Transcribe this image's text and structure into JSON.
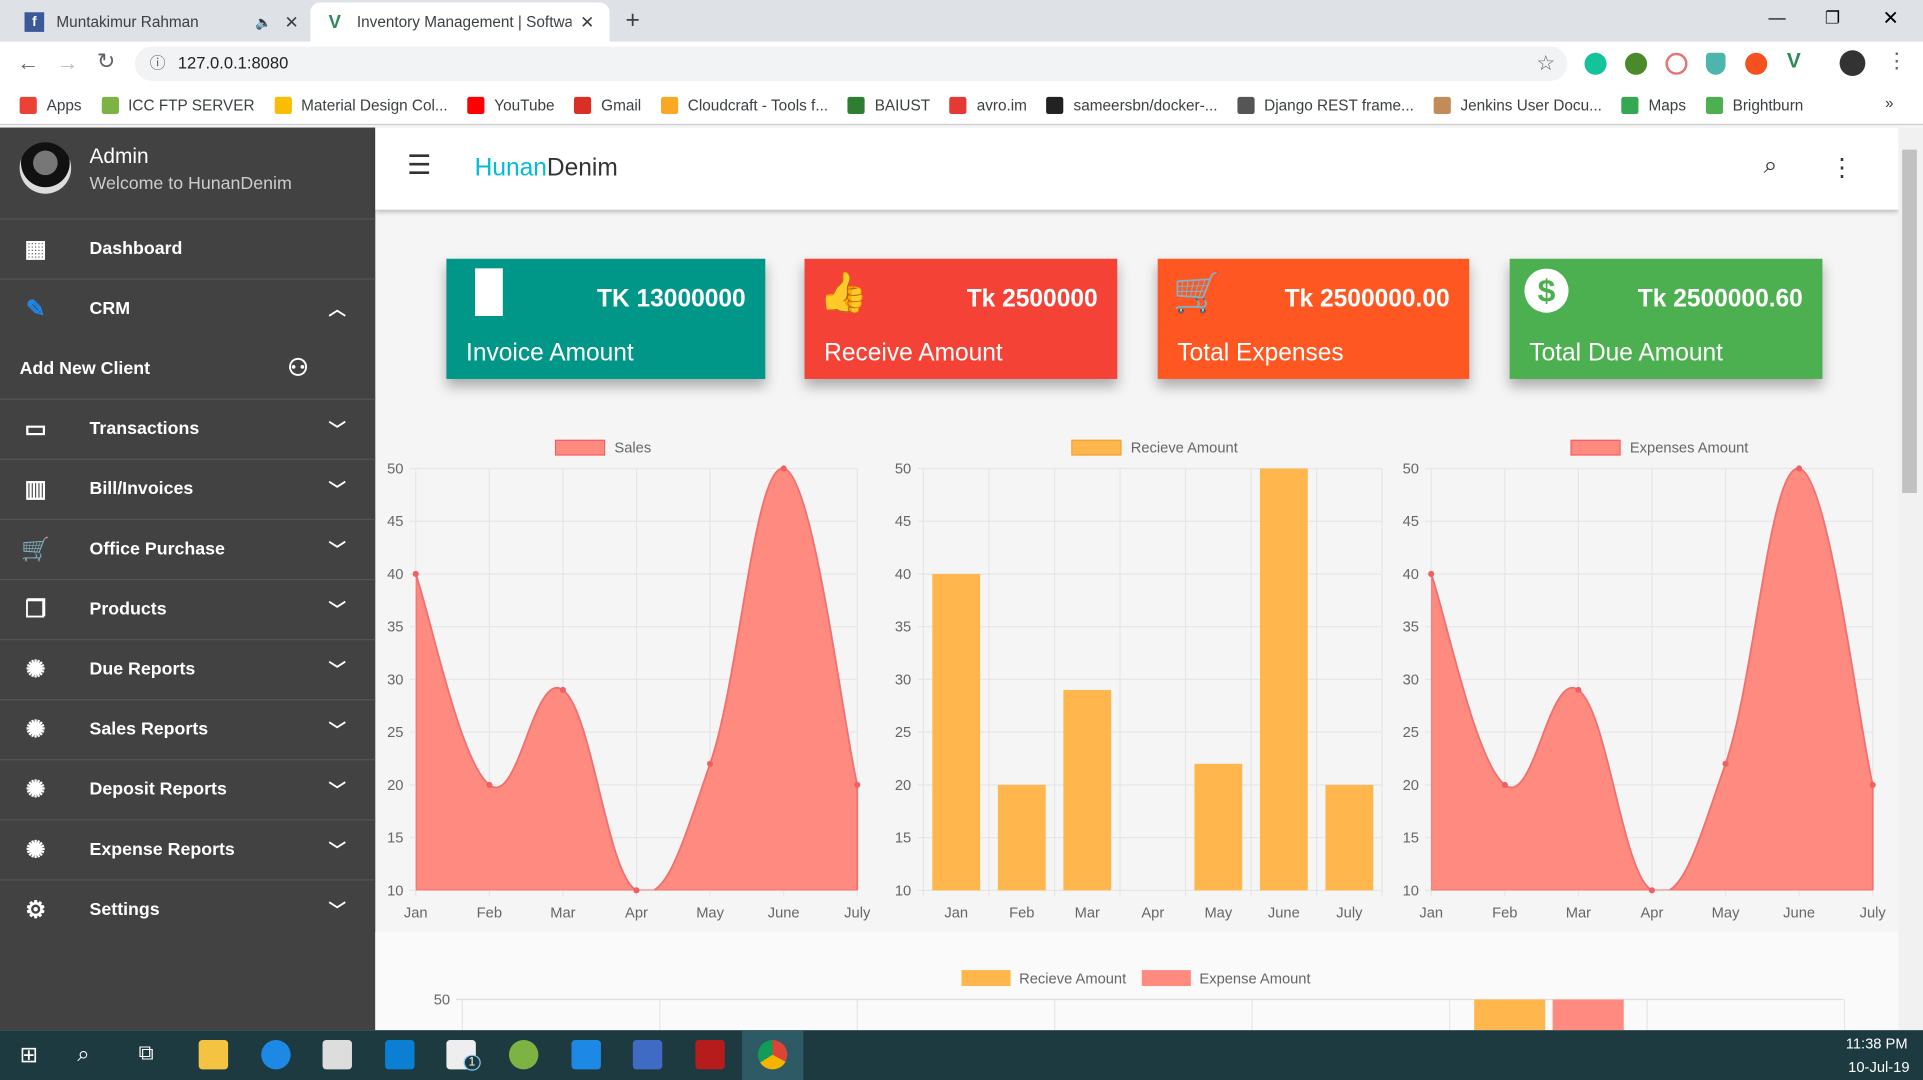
{
  "browser": {
    "tabs": [
      {
        "title": "Muntakimur Rahman",
        "icon": "facebook-icon"
      },
      {
        "title": "Inventory Management | Softwar",
        "icon": "vue-icon"
      }
    ],
    "url": "127.0.0.1:8080",
    "bookmarks": [
      "Apps",
      "ICC FTP SERVER",
      "Material Design Col...",
      "YouTube",
      "Gmail",
      "Cloudcraft - Tools f...",
      "BAIUST",
      "avro.im",
      "sameersbn/docker-...",
      "Django REST frame...",
      "Jenkins User Docu...",
      "Maps",
      "Brightburn"
    ]
  },
  "sidebar": {
    "user": {
      "name": "Admin",
      "subtitle": "Welcome to HunanDenim"
    },
    "items": [
      {
        "label": "Dashboard",
        "icon": "dashboard-icon"
      },
      {
        "label": "CRM",
        "icon": "crm-icon",
        "expanded": true
      },
      {
        "label": "Add New Client",
        "icon": "people-icon"
      },
      {
        "label": "Transactions",
        "icon": "laptop-icon"
      },
      {
        "label": "Bill/Invoices",
        "icon": "bar-chart-icon"
      },
      {
        "label": "Office Purchase",
        "icon": "cart-icon"
      },
      {
        "label": "Products",
        "icon": "copy-icon"
      },
      {
        "label": "Due Reports",
        "icon": "bug-icon"
      },
      {
        "label": "Sales Reports",
        "icon": "bug-icon"
      },
      {
        "label": "Deposit Reports",
        "icon": "bug-icon"
      },
      {
        "label": "Expense Reports",
        "icon": "bug-icon"
      },
      {
        "label": "Settings",
        "icon": "gear-icon"
      }
    ]
  },
  "header": {
    "brand_a": "Hunan",
    "brand_b": "Denim",
    "brand_color": "#00bcd4"
  },
  "cards": [
    {
      "amount": "TK 13000000",
      "title": "Invoice Amount",
      "color": "#009688",
      "icon": "bar-chart-icon"
    },
    {
      "amount": "Tk 2500000",
      "title": "Receive Amount",
      "color": "#f44336",
      "icon": "thumbs-icon"
    },
    {
      "amount": "Tk 2500000.00",
      "title": "Total Expenses",
      "color": "#ff5722",
      "icon": "cart-icon"
    },
    {
      "amount": "Tk 2500000.60",
      "title": "Total Due Amount",
      "color": "#4caf50",
      "icon": "dollar-icon"
    }
  ],
  "chart_data": [
    {
      "type": "area",
      "legend": [
        "Sales"
      ],
      "color": "#ff8a80",
      "categories": [
        "Jan",
        "Feb",
        "Mar",
        "Apr",
        "May",
        "June",
        "July"
      ],
      "values": [
        40,
        20,
        29,
        10,
        22,
        50,
        20
      ],
      "ylim": [
        10,
        50
      ],
      "yticks": [
        10,
        15,
        20,
        25,
        30,
        35,
        40,
        45,
        50
      ],
      "grid": true,
      "legend_position": "top"
    },
    {
      "type": "bar",
      "legend": [
        "Recieve Amount"
      ],
      "color": "#ffb74d",
      "categories": [
        "Jan",
        "Feb",
        "Mar",
        "Apr",
        "May",
        "June",
        "July"
      ],
      "values": [
        40,
        20,
        29,
        10,
        22,
        50,
        20
      ],
      "ylim": [
        10,
        50
      ],
      "yticks": [
        10,
        15,
        20,
        25,
        30,
        35,
        40,
        45,
        50
      ],
      "grid": true,
      "legend_position": "top"
    },
    {
      "type": "area",
      "legend": [
        "Expenses Amount"
      ],
      "color": "#ff8a80",
      "categories": [
        "Jan",
        "Feb",
        "Mar",
        "Apr",
        "May",
        "June",
        "July"
      ],
      "values": [
        40,
        20,
        29,
        10,
        22,
        50,
        20
      ],
      "ylim": [
        10,
        50
      ],
      "yticks": [
        10,
        15,
        20,
        25,
        30,
        35,
        40,
        45,
        50
      ],
      "grid": true,
      "legend_position": "top"
    },
    {
      "type": "bar",
      "partial": true,
      "series": [
        {
          "name": "Recieve Amount",
          "color": "#ffb74d"
        },
        {
          "name": "Expense Amount",
          "color": "#ff8a80"
        }
      ],
      "yticks_visible": [
        50
      ],
      "grid": true,
      "legend_position": "top"
    }
  ],
  "taskbar": {
    "time": "11:38 PM",
    "date": "10-Jul-19",
    "mail_badge": "1"
  }
}
